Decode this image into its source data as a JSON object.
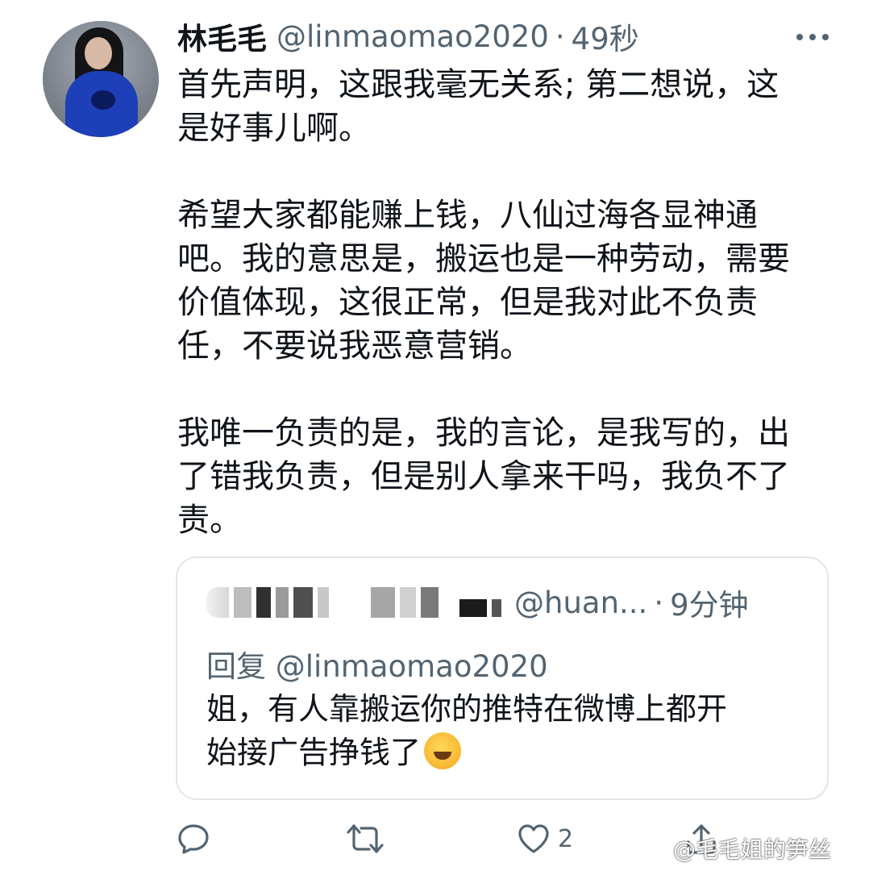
{
  "tweet": {
    "author_name": "林毛毛",
    "handle": "@linmaomao2020",
    "separator": "·",
    "time": "49秒",
    "text": "首先声明，这跟我毫无关系; 第二想说，这\n是好事儿啊。\n\n希望大家都能赚上钱，八仙过海各显神通\n吧。我的意思是，搬运也是一种劳动，需要\n价值体现，这很正常，但是我对此不负责\n任，不要说我恶意营销。\n\n我唯一负责的是，我的言论，是我写的，出\n了错我负责，但是别人拿来干吗，我负不了\n责。"
  },
  "quote": {
    "handle": "@huan...",
    "separator": "·",
    "time": "9分钟",
    "reply_prefix": "回复",
    "reply_to": "@linmaomao2020",
    "text": "姐，有人靠搬运你的推特在微博上都开\n始接广告挣钱了"
  },
  "actions": {
    "like_count": "2"
  },
  "watermark": "@毛毛姐的笋丝",
  "colors": {
    "text_primary": "#0f1419",
    "text_secondary": "#536471",
    "border": "#e1e6ea"
  }
}
